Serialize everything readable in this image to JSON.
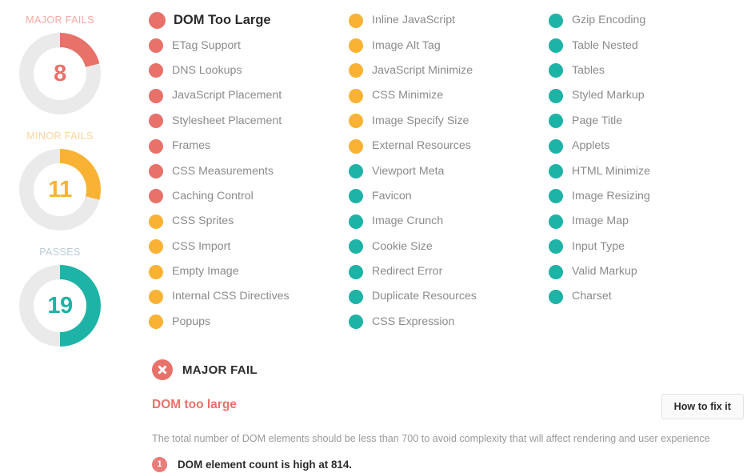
{
  "gauges": [
    {
      "label": "MAJOR FAILS",
      "value": "8",
      "percent": 21,
      "color": "#e8716a",
      "track": "#eaeaea",
      "label_color": "#f4aaa4",
      "name": "major-fails"
    },
    {
      "label": "MINOR FAILS",
      "value": "11",
      "percent": 29,
      "color": "#f9b233",
      "track": "#eaeaea",
      "label_color": "#fcd59a",
      "name": "minor-fails"
    },
    {
      "label": "PASSES",
      "value": "19",
      "percent": 50,
      "color": "#1eb3a7",
      "track": "#eaeaea",
      "label_color": "#b9cdd8",
      "name": "passes"
    }
  ],
  "legend_colors": {
    "major_fail": "#e8716a",
    "minor_fail": "#f9b233",
    "pass": "#1eb3a7",
    "track": "#eaeaea"
  },
  "checks": {
    "columns": [
      {
        "items": [
          {
            "label": "DOM Too Large",
            "status": "red",
            "active": true
          },
          {
            "label": "ETag Support",
            "status": "red",
            "active": false
          },
          {
            "label": "DNS Lookups",
            "status": "red",
            "active": false
          },
          {
            "label": "JavaScript Placement",
            "status": "red",
            "active": false
          },
          {
            "label": "Stylesheet Placement",
            "status": "red",
            "active": false
          },
          {
            "label": "Frames",
            "status": "red",
            "active": false
          },
          {
            "label": "CSS Measurements",
            "status": "red",
            "active": false
          },
          {
            "label": "Caching Control",
            "status": "red",
            "active": false
          },
          {
            "label": "CSS Sprites",
            "status": "yellow",
            "active": false
          },
          {
            "label": "CSS Import",
            "status": "yellow",
            "active": false
          },
          {
            "label": "Empty Image",
            "status": "yellow",
            "active": false
          },
          {
            "label": "Internal CSS Directives",
            "status": "yellow",
            "active": false
          },
          {
            "label": "Popups",
            "status": "yellow",
            "active": false
          }
        ]
      },
      {
        "items": [
          {
            "label": "Inline JavaScript",
            "status": "yellow",
            "active": false
          },
          {
            "label": "Image Alt Tag",
            "status": "yellow",
            "active": false
          },
          {
            "label": "JavaScript Minimize",
            "status": "yellow",
            "active": false
          },
          {
            "label": "CSS Minimize",
            "status": "yellow",
            "active": false
          },
          {
            "label": "Image Specify Size",
            "status": "yellow",
            "active": false
          },
          {
            "label": "External Resources",
            "status": "yellow",
            "active": false
          },
          {
            "label": "Viewport Meta",
            "status": "teal",
            "active": false
          },
          {
            "label": "Favicon",
            "status": "teal",
            "active": false
          },
          {
            "label": "Image Crunch",
            "status": "teal",
            "active": false
          },
          {
            "label": "Cookie Size",
            "status": "teal",
            "active": false
          },
          {
            "label": "Redirect Error",
            "status": "teal",
            "active": false
          },
          {
            "label": "Duplicate Resources",
            "status": "teal",
            "active": false
          },
          {
            "label": "CSS Expression",
            "status": "teal",
            "active": false
          }
        ]
      },
      {
        "items": [
          {
            "label": "Gzip Encoding",
            "status": "teal",
            "active": false
          },
          {
            "label": "Table Nested",
            "status": "teal",
            "active": false
          },
          {
            "label": "Tables",
            "status": "teal",
            "active": false
          },
          {
            "label": "Styled Markup",
            "status": "teal",
            "active": false
          },
          {
            "label": "Page Title",
            "status": "teal",
            "active": false
          },
          {
            "label": "Applets",
            "status": "teal",
            "active": false
          },
          {
            "label": "HTML Minimize",
            "status": "teal",
            "active": false
          },
          {
            "label": "Image Resizing",
            "status": "teal",
            "active": false
          },
          {
            "label": "Image Map",
            "status": "teal",
            "active": false
          },
          {
            "label": "Input Type",
            "status": "teal",
            "active": false
          },
          {
            "label": "Valid Markup",
            "status": "teal",
            "active": false
          },
          {
            "label": "Charset",
            "status": "teal",
            "active": false
          }
        ]
      }
    ]
  },
  "detail": {
    "severity": "MAJOR FAIL",
    "title": "DOM too large",
    "fix_button": "How to fix it",
    "description": "The total number of DOM elements should be less than 700 to avoid complexity that will affect rendering and user experience",
    "findings": [
      {
        "number": "1",
        "text": "DOM element count is high at 814."
      }
    ]
  }
}
